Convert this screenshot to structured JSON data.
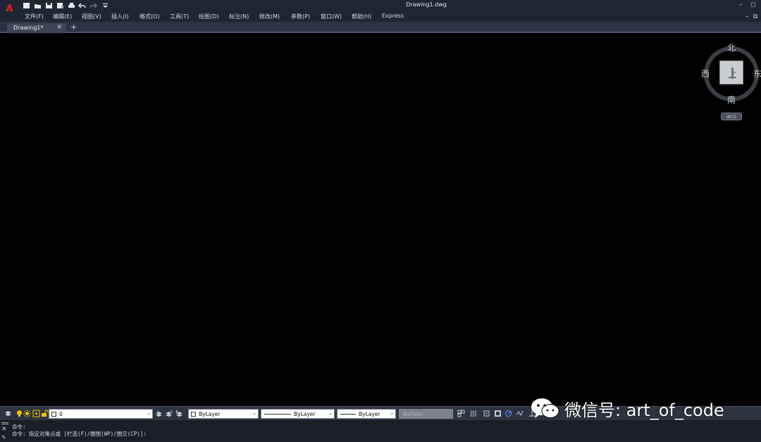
{
  "window": {
    "title": "Drawing1.dwg",
    "controls": {
      "minimize": "–",
      "restore": "◻"
    },
    "mdi_controls": {
      "minimize": "–",
      "restore": "⧉"
    }
  },
  "qat": {
    "icons": [
      "new-icon",
      "open-icon",
      "save-icon",
      "save-as-icon",
      "print-icon",
      "undo-icon",
      "redo-icon",
      "customize-icon"
    ]
  },
  "menu": {
    "items": [
      {
        "label": "文件(F)"
      },
      {
        "label": "编辑(E)"
      },
      {
        "label": "视图(V)"
      },
      {
        "label": "插入(I)"
      },
      {
        "label": "格式(O)"
      },
      {
        "label": "工具(T)"
      },
      {
        "label": "绘图(D)"
      },
      {
        "label": "标注(N)"
      },
      {
        "label": "修改(M)"
      },
      {
        "label": "参数(P)"
      },
      {
        "label": "窗口(W)"
      },
      {
        "label": "帮助(H)"
      },
      {
        "label": "Express"
      }
    ]
  },
  "tabs": {
    "items": [
      {
        "label": "Drawing1*",
        "active": true
      }
    ],
    "close_glyph": "✕",
    "add_glyph": "+"
  },
  "viewcube": {
    "north": "北",
    "south": "南",
    "east": "东",
    "west": "西",
    "face": "上",
    "wcs": "WCS"
  },
  "properties": {
    "layer": "0",
    "color": "ByLayer",
    "linetype": "ByLayer",
    "lineweight": "ByLayer",
    "plotstyle": "ByColor"
  },
  "command": {
    "lines": [
      "命令:",
      "命令: 指定对角点或 [栏选(F)/圈围(WP)/圈交(CP)]:"
    ]
  },
  "watermark": {
    "text": "微信号: art_of_code"
  },
  "colors": {
    "accent": "#cc1f1f",
    "chrome": "#1f2633",
    "canvas": "#000000"
  }
}
